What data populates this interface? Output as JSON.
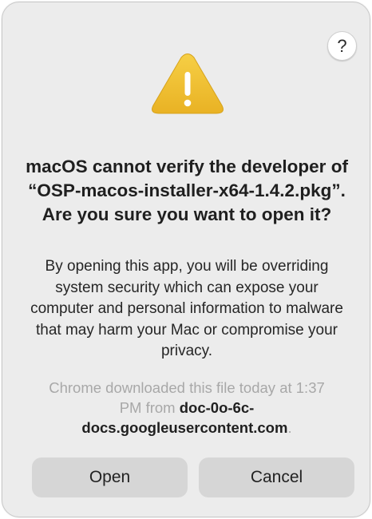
{
  "dialog": {
    "help_label": "?",
    "headline": "macOS cannot verify the developer of “OSP-macos-installer-x64-1.4.2.pkg”. Are you sure you want to open it?",
    "body": "By opening this app, you will be overriding system security which can expose your computer and personal information to malware that may harm your Mac or compromise your privacy.",
    "source_prefix": "Chrome downloaded this file today at 1:37 PM from ",
    "source_host": "doc-0o-6c-docs.googleusercontent.com",
    "source_suffix": ".",
    "buttons": {
      "open_label": "Open",
      "cancel_label": "Cancel"
    }
  },
  "icons": {
    "warning": "warning-triangle-icon",
    "help": "question-mark-icon"
  },
  "colors": {
    "dialog_background": "#ececec",
    "warning_yellow": "#f2c230",
    "button_background": "#d6d6d6"
  }
}
